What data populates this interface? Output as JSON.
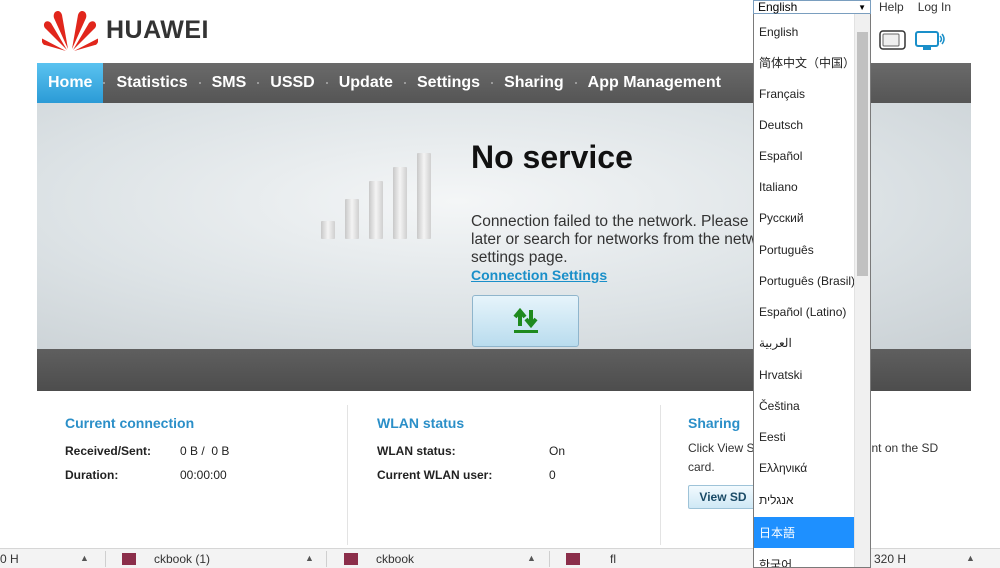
{
  "header": {
    "brand": "HUAWEI",
    "links": {
      "help": "Help",
      "login": "Log In"
    },
    "icons": [
      "sim-icon",
      "monitor-icon"
    ]
  },
  "nav": {
    "items": [
      "Home",
      "Statistics",
      "SMS",
      "USSD",
      "Update",
      "Settings",
      "Sharing",
      "App Management"
    ],
    "active": "Home"
  },
  "status": {
    "title": "No service",
    "message": "Connection failed to the network. Please\nlater or search for networks from the netw\nsettings page.",
    "link": "Connection Settings",
    "signal_bars_lit": 0
  },
  "current_connection": {
    "title": "Current connection",
    "rows": [
      {
        "label": "Received/Sent:",
        "value": "0 B /  0 B"
      },
      {
        "label": "Duration:",
        "value": "00:00:00"
      }
    ]
  },
  "wlan_status": {
    "title": "WLAN status",
    "rows": [
      {
        "label": "WLAN status:",
        "value": "On"
      },
      {
        "label": "Current WLAN user:",
        "value": "0"
      }
    ]
  },
  "sharing": {
    "title": "Sharing",
    "text_left": "Click View S",
    "text_right": "tent on the SD",
    "text_line2": "card.",
    "button": "View SD"
  },
  "language_dropdown": {
    "selected_value": "English",
    "options": [
      "English",
      "简体中文（中国）",
      "Français",
      "Deutsch",
      "Español",
      "Italiano",
      "Русский",
      "Português",
      "Português (Brasil)",
      "Español (Latino)",
      "العربية",
      "Hrvatski",
      "Čeština",
      "Eesti",
      "Ελληνικά",
      "אנגלית",
      "日本語",
      "한국어"
    ],
    "highlighted": "日本語"
  },
  "download_bar": {
    "items": [
      "0 H",
      "ckbook (1)",
      "ckbook",
      "fl",
      "320 H"
    ]
  },
  "colors": {
    "nav_active": "#2b9bd6",
    "nav_bg": "#5f5f5f",
    "section_title": "#2b8fc8",
    "highlight": "#1e90ff",
    "brand_red": "#e1261c"
  }
}
